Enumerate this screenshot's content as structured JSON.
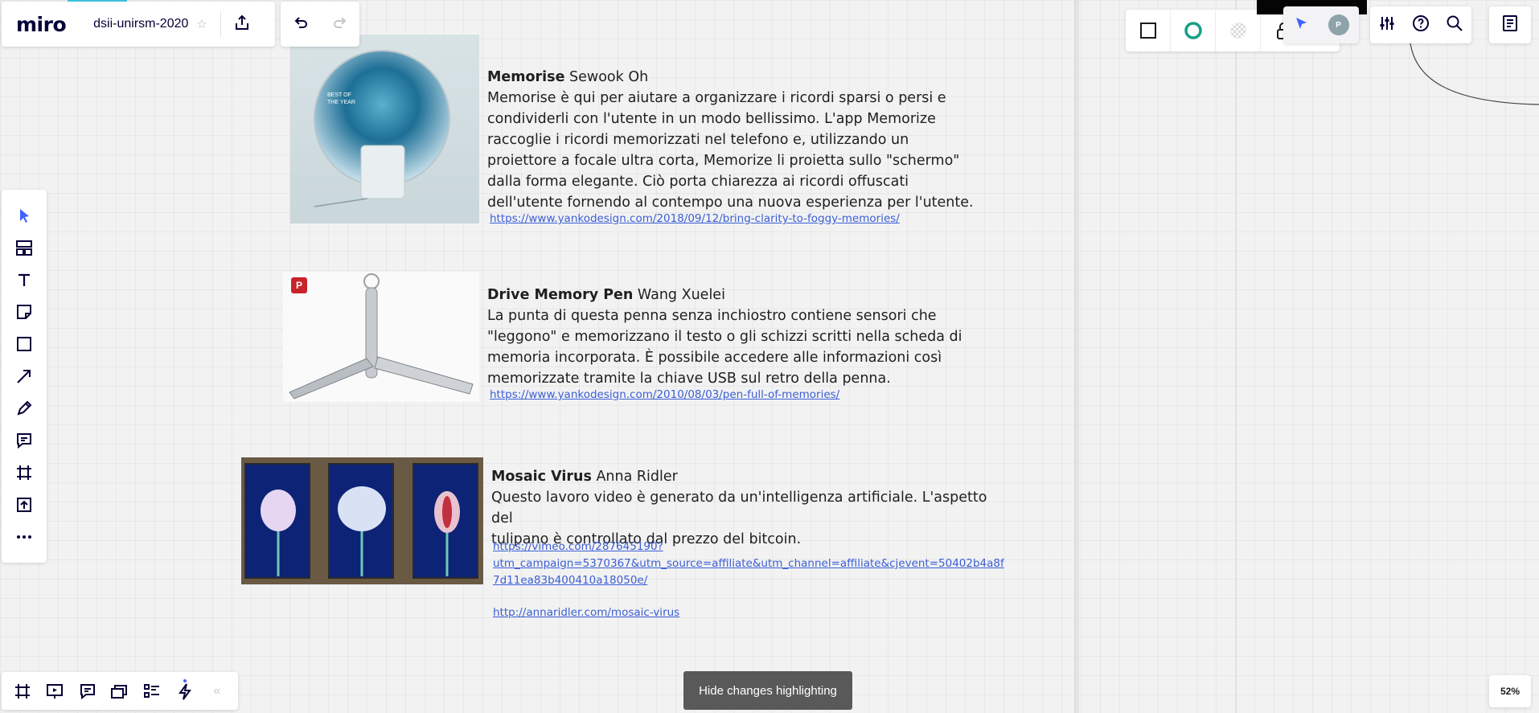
{
  "header": {
    "logo": "miro",
    "board_title": "dsii-unirsm-2020",
    "star_icon": "star-icon",
    "share_icon": "share-icon"
  },
  "history": {
    "undo_icon": "undo-icon",
    "redo_icon": "redo-icon"
  },
  "context_toolbar": {
    "items": [
      "square-shape-icon",
      "circle-outline-icon",
      "transparent-fill-icon",
      "lock-icon"
    ],
    "circle_color": "#16a085"
  },
  "collaborators": {
    "cursor_icon": "cursor-flag-icon",
    "avatar_initial": "P"
  },
  "right_tools": [
    "settings-sliders-icon",
    "help-icon",
    "search-icon"
  ],
  "notes_icon": "notes-icon",
  "left_toolbar": [
    "select-cursor-icon",
    "templates-icon",
    "text-icon",
    "sticky-note-icon",
    "shape-icon",
    "arrow-line-icon",
    "pen-icon",
    "comment-icon",
    "frame-icon",
    "upload-icon",
    "more-icon"
  ],
  "bottom_toolbar": [
    "frames-icon",
    "presentation-icon",
    "comments-icon",
    "cards-icon",
    "list-icon",
    "bolt-icon",
    "collapse-icon"
  ],
  "hide_changes_label": "Hide changes highlighting",
  "zoom_level": "52%",
  "board_items": {
    "memorise": {
      "title": "Memorise",
      "author": " Sewook Oh",
      "line1": "Memorise è qui per aiutare a organizzare i ricordi sparsi o persi e",
      "line2": "condividerli con l'utente in un modo bellissimo. L'app Memorize",
      "line3": "raccoglie i ricordi memorizzati nel telefono e, utilizzando un",
      "line4": "proiettore a focale ultra corta, Memorize li proietta sullo \"schermo\"",
      "line5": "dalla forma elegante. Ciò porta chiarezza ai ricordi offuscati",
      "line6": "dell'utente fornendo al contempo una nuova esperienza per l'utente.",
      "link": "https://www.yankodesign.com/2018/09/12/bring-clarity-to-foggy-memories/",
      "image_text_1": "BEST OF",
      "image_text_2": "THE YEAR"
    },
    "pen": {
      "title": "Drive Memory Pen",
      "author": " Wang Xuelei",
      "line1": "La punta di questa penna senza inchiostro contiene sensori che",
      "line2": "\"leggono\" e memorizzano il testo o gli schizzi scritti nella scheda di",
      "line3": "memoria incorporata. È possibile accedere alle informazioni così",
      "line4": "memorizzate tramite la chiave USB sul retro della penna.",
      "link": "https://www.yankodesign.com/2010/08/03/pen-full-of-memories/",
      "badge": "P"
    },
    "mosaic": {
      "title": "Mosaic Virus",
      "author": " Anna Ridler",
      "line1": "Questo lavoro video è generato da un'intelligenza artificiale. L'aspetto del",
      "line2": "tulipano è controllato dal prezzo del bitcoin.",
      "link1_l1": "https://vimeo.com/287645190?",
      "link1_l2": "utm_campaign=5370367&utm_source=affiliate&utm_channel=affiliate&cjevent=50402b4a8f",
      "link1_l3": "7d11ea83b400410a18050e/",
      "link2": "http://annaridler.com/mosaic-virus"
    }
  }
}
